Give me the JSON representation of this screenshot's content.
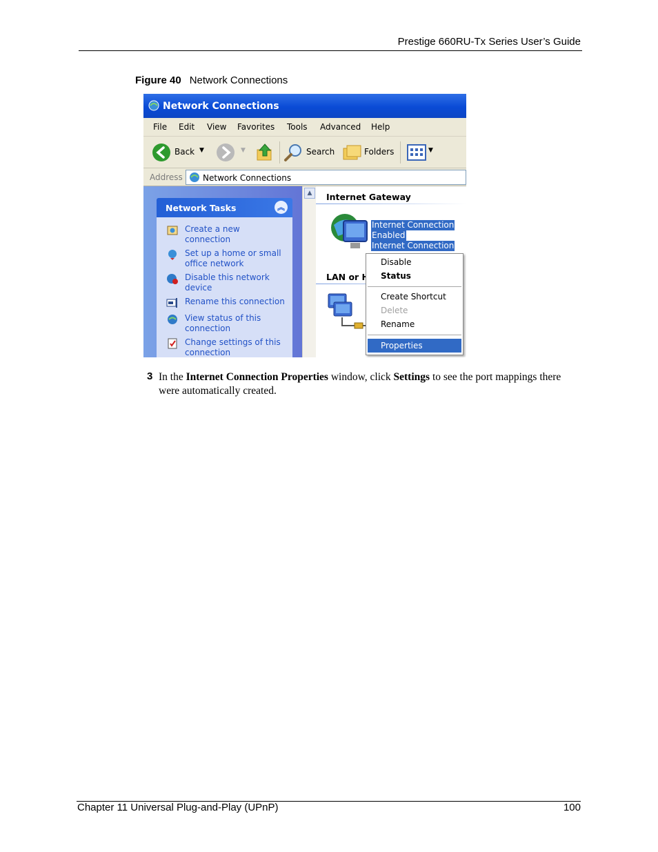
{
  "header": {
    "doc_title": "Prestige 660RU-Tx Series User’s Guide"
  },
  "figure": {
    "label": "Figure 40",
    "caption": "Network Connections"
  },
  "window": {
    "title": "Network Connections",
    "menu": [
      "File",
      "Edit",
      "View",
      "Favorites",
      "Tools",
      "Advanced",
      "Help"
    ],
    "toolbar": {
      "back": "Back",
      "search": "Search",
      "folders": "Folders"
    },
    "address": {
      "label": "Address",
      "value": "Network Connections"
    },
    "tasks": {
      "title": "Network Tasks",
      "items": [
        [
          "Create a new",
          "connection"
        ],
        [
          "Set up a home or small",
          "office network"
        ],
        [
          "Disable this network",
          "device"
        ],
        [
          "Rename this connection"
        ],
        [
          "View status of this",
          "connection"
        ],
        [
          "Change settings of this",
          "connection"
        ]
      ]
    },
    "content": {
      "group1_title": "Internet Gateway",
      "item_lines": [
        "Internet Connection",
        "Enabled",
        "Internet Connection"
      ],
      "group2_title": "LAN or H"
    },
    "context_menu": {
      "disable": "Disable",
      "status": "Status",
      "create_shortcut": "Create Shortcut",
      "delete": "Delete",
      "rename": "Rename",
      "properties": "Properties"
    }
  },
  "step": {
    "number": "3",
    "t1": "In the ",
    "b1": "Internet Connection Properties",
    "t2": " window, click ",
    "b2": "Settings",
    "t3": " to see the port mappings there were automatically created."
  },
  "footer": {
    "chapter": "Chapter 11 Universal Plug-and-Play (UPnP)",
    "page": "100"
  }
}
